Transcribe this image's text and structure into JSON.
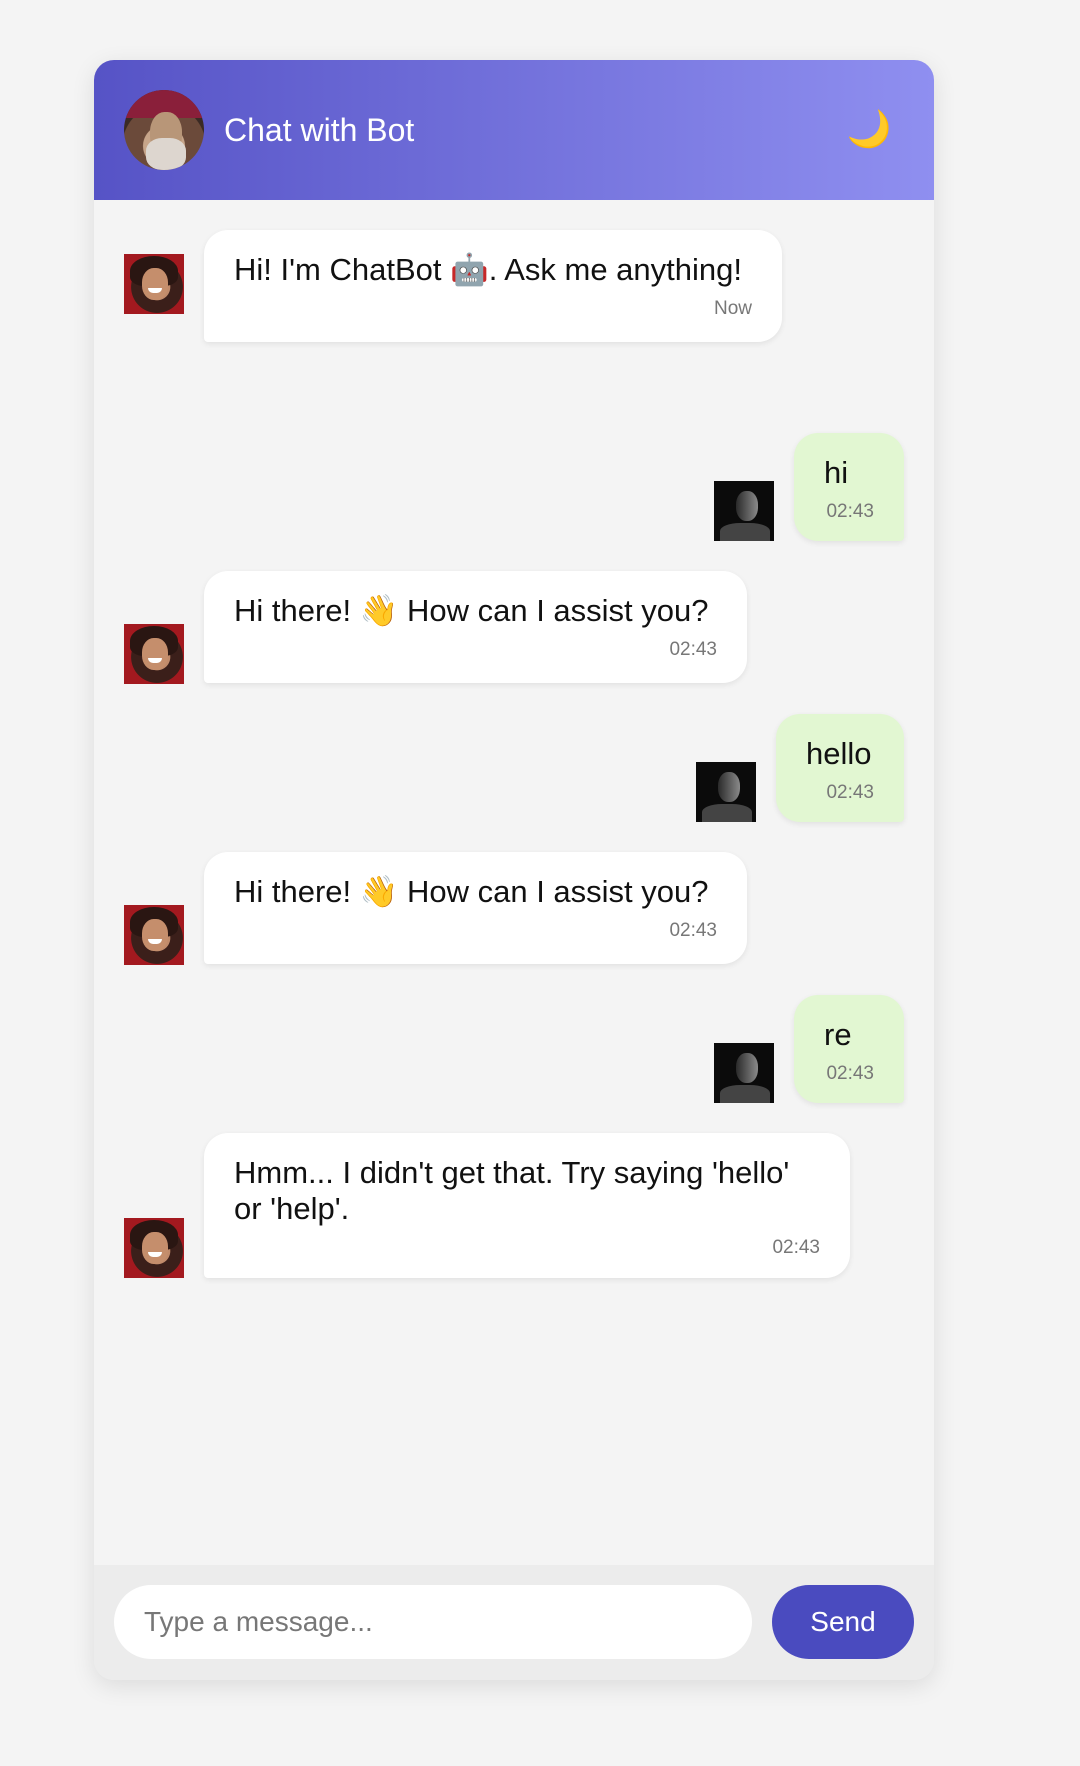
{
  "header": {
    "title": "Chat with Bot",
    "avatar_icon": "bot-profile-avatar",
    "theme_toggle_icon": "moon-icon",
    "theme_toggle_glyph": "🌙"
  },
  "messages": [
    {
      "sender": "bot",
      "text": "Hi! I'm ChatBot 🤖. Ask me anything!",
      "time": "Now"
    },
    {
      "sender": "user",
      "text": "hi",
      "time": "02:43"
    },
    {
      "sender": "bot",
      "text": "Hi there! 👋 How can I assist you?",
      "time": "02:43"
    },
    {
      "sender": "user",
      "text": "hello",
      "time": "02:43"
    },
    {
      "sender": "bot",
      "text": "Hi there! 👋 How can I assist you?",
      "time": "02:43"
    },
    {
      "sender": "user",
      "text": "re",
      "time": "02:43"
    },
    {
      "sender": "bot",
      "text": "Hmm... I didn't get that. Try saying 'hello'\nor 'help'.",
      "time": "02:43"
    }
  ],
  "composer": {
    "placeholder": "Type a message...",
    "value": "",
    "send_label": "Send"
  },
  "colors": {
    "header_gradient_start": "#5653c6",
    "header_gradient_end": "#8f8ff0",
    "bot_bubble": "#ffffff",
    "user_bubble": "#e2f7d2",
    "send_button": "#4a4bbf"
  }
}
